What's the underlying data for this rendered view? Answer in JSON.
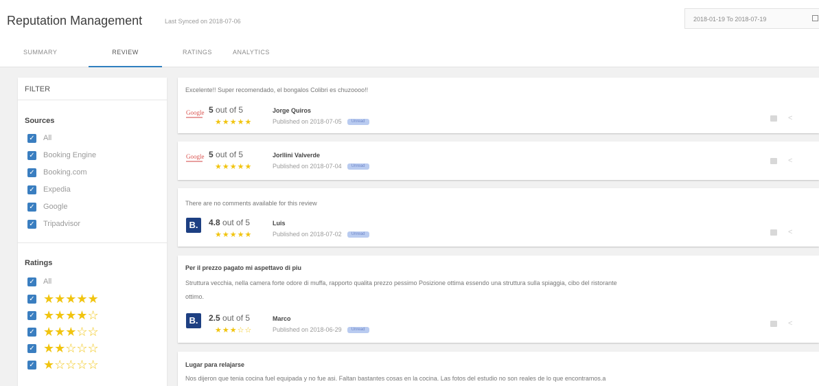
{
  "header": {
    "title": "Reputation Management",
    "last_synced": "Last Synced on 2018-07-06",
    "date_range": "2018-01-19 To 2018-07-19",
    "calendar_icon": "calendar-icon"
  },
  "tabs": [
    {
      "label": "SUMMARY",
      "active": false
    },
    {
      "label": "REVIEW",
      "active": true
    },
    {
      "label": "RATINGS",
      "active": false
    },
    {
      "label": "ANALYTICS",
      "active": false
    }
  ],
  "filter": {
    "heading": "FILTER",
    "sources": {
      "title": "Sources",
      "items": [
        "All",
        "Booking Engine",
        "Booking.com",
        "Expedia",
        "Google",
        "Tripadvisor"
      ]
    },
    "ratings": {
      "title": "Ratings",
      "all_label": "All",
      "star_levels": [
        5,
        4,
        3,
        2,
        1
      ]
    }
  },
  "reviews": [
    {
      "comment": "Excelente!! Super recomendado, el bongalos Colibri es chuzoooo!!",
      "source": "google",
      "logo_text": "Google",
      "rating": "5",
      "out_of": "out of 5",
      "stars": 5,
      "reviewer": "Jorge Quiros",
      "published": "Published on 2018-07-05",
      "badge": "Unread"
    },
    {
      "source": "google",
      "logo_text": "Google",
      "rating": "5",
      "out_of": "out of 5",
      "stars": 5,
      "reviewer": "Jorllini Valverde",
      "published": "Published on 2018-07-04",
      "badge": "Unread"
    },
    {
      "comment": "There are no comments available for this review",
      "source": "booking",
      "logo_text": "B.",
      "rating": "4.8",
      "out_of": "out of 5",
      "stars": 5,
      "reviewer": "Luis",
      "published": "Published on 2018-07-02",
      "badge": "Unread"
    },
    {
      "title": "Per il prezzo pagato mi aspettavo di piu",
      "comment": "Struttura vecchia, nella camera forte odore di muffa, rapporto qualita prezzo pessimo Posizione ottima essendo una struttura sulla spiaggia, cibo del ristorante",
      "comment_line2": "ottimo.",
      "source": "booking",
      "logo_text": "B.",
      "rating": "2.5",
      "out_of": "out of 5",
      "stars": 2.5,
      "reviewer": "Marco",
      "published": "Published on 2018-06-29",
      "badge": "Unread"
    },
    {
      "title": "Lugar para relajarse",
      "comment": "Nos dijeron que tenia cocina fuel equipada y no fue asi. Faltan bastantes cosas en la cocina. Las fotos del estudio no son reales de lo que encontramos.a"
    }
  ],
  "icons": {
    "message": "message-icon",
    "share": "share-icon"
  }
}
